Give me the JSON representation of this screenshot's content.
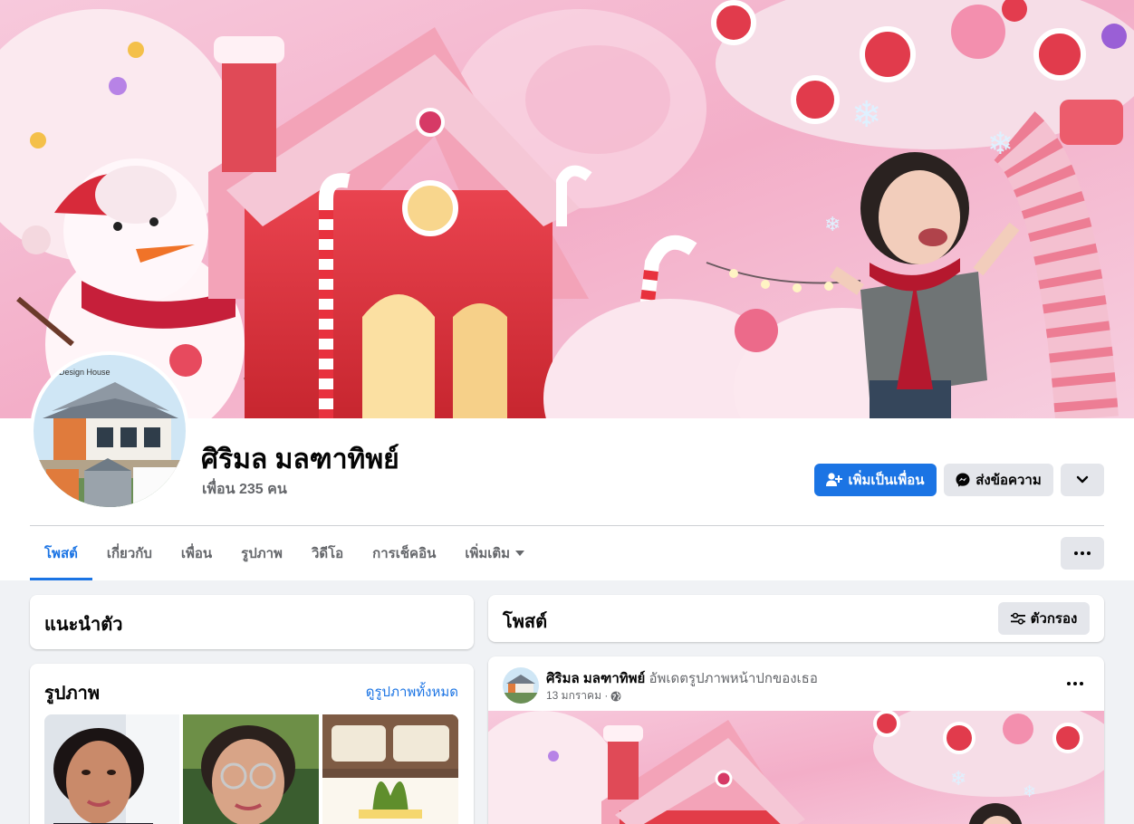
{
  "profile": {
    "name": "ศิริมล มลฑาทิพย์",
    "friends_count": "เพื่อน 235 คน",
    "avatar_caption": "Design House"
  },
  "actions": {
    "add_friend": "เพิ่มเป็นเพื่อน",
    "message": "ส่งข้อความ"
  },
  "tabs": [
    {
      "label": "โพสต์",
      "active": true
    },
    {
      "label": "เกี่ยวกับ"
    },
    {
      "label": "เพื่อน"
    },
    {
      "label": "รูปภาพ"
    },
    {
      "label": "วิดีโอ"
    },
    {
      "label": "การเช็คอิน"
    },
    {
      "label": "เพิ่มเติม"
    }
  ],
  "intro": {
    "title": "แนะนำตัว"
  },
  "photos": {
    "title": "รูปภาพ",
    "see_all": "ดูรูปภาพทั้งหมด"
  },
  "posts_header": {
    "title": "โพสต์",
    "filter_label": "ตัวกรอง"
  },
  "post": {
    "author": "ศิริมล มลฑาทิพย์",
    "action": "อัพเดตรูปภาพหน้าปกของเธอ",
    "date": "13 มกราคม ·"
  },
  "colors": {
    "accent": "#1b74e4",
    "background": "#f0f2f5",
    "button_gray": "#e4e6eb",
    "secondary_text": "#65676b"
  },
  "icons": [
    "add-friend-icon",
    "messenger-icon",
    "chevron-down-icon",
    "more-icon",
    "filter-icon",
    "globe-icon",
    "caret-down-icon"
  ]
}
